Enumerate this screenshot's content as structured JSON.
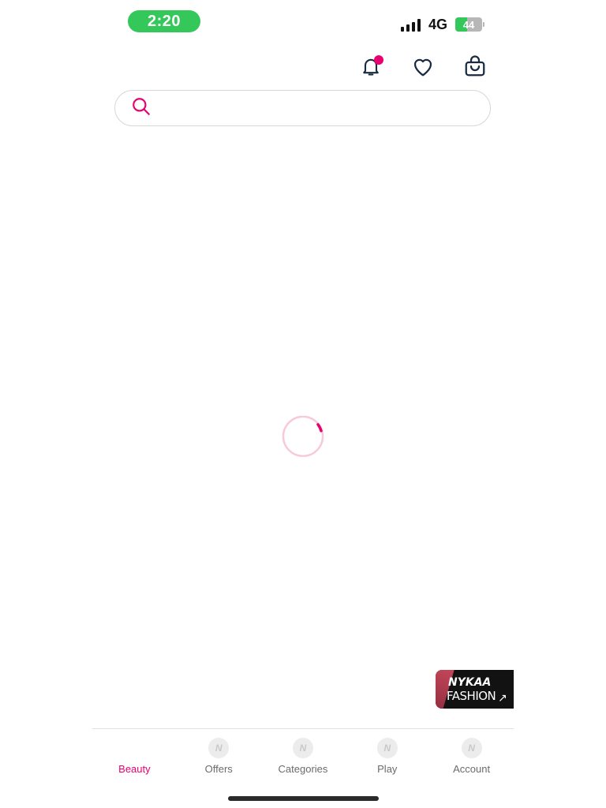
{
  "status_bar": {
    "time": "2:20",
    "network": "4G",
    "battery_percent": 44,
    "battery_label": "44"
  },
  "header": {
    "icons": [
      "bell-icon",
      "heart-icon",
      "shopping-bag-icon"
    ],
    "notification_badge": true
  },
  "search": {
    "placeholder": "",
    "value": ""
  },
  "loading": true,
  "promo": {
    "title": "NYKAA",
    "subtitle": "FASHION",
    "arrow": "↗"
  },
  "bottom_nav": {
    "items": [
      {
        "label": "Beauty",
        "active": true
      },
      {
        "label": "Offers",
        "active": false
      },
      {
        "label": "Categories",
        "active": false
      },
      {
        "label": "Play",
        "active": false
      },
      {
        "label": "Account",
        "active": false
      }
    ]
  },
  "colors": {
    "brand": "#e80071",
    "time_pill": "#34c759",
    "battery": "#34c759"
  }
}
